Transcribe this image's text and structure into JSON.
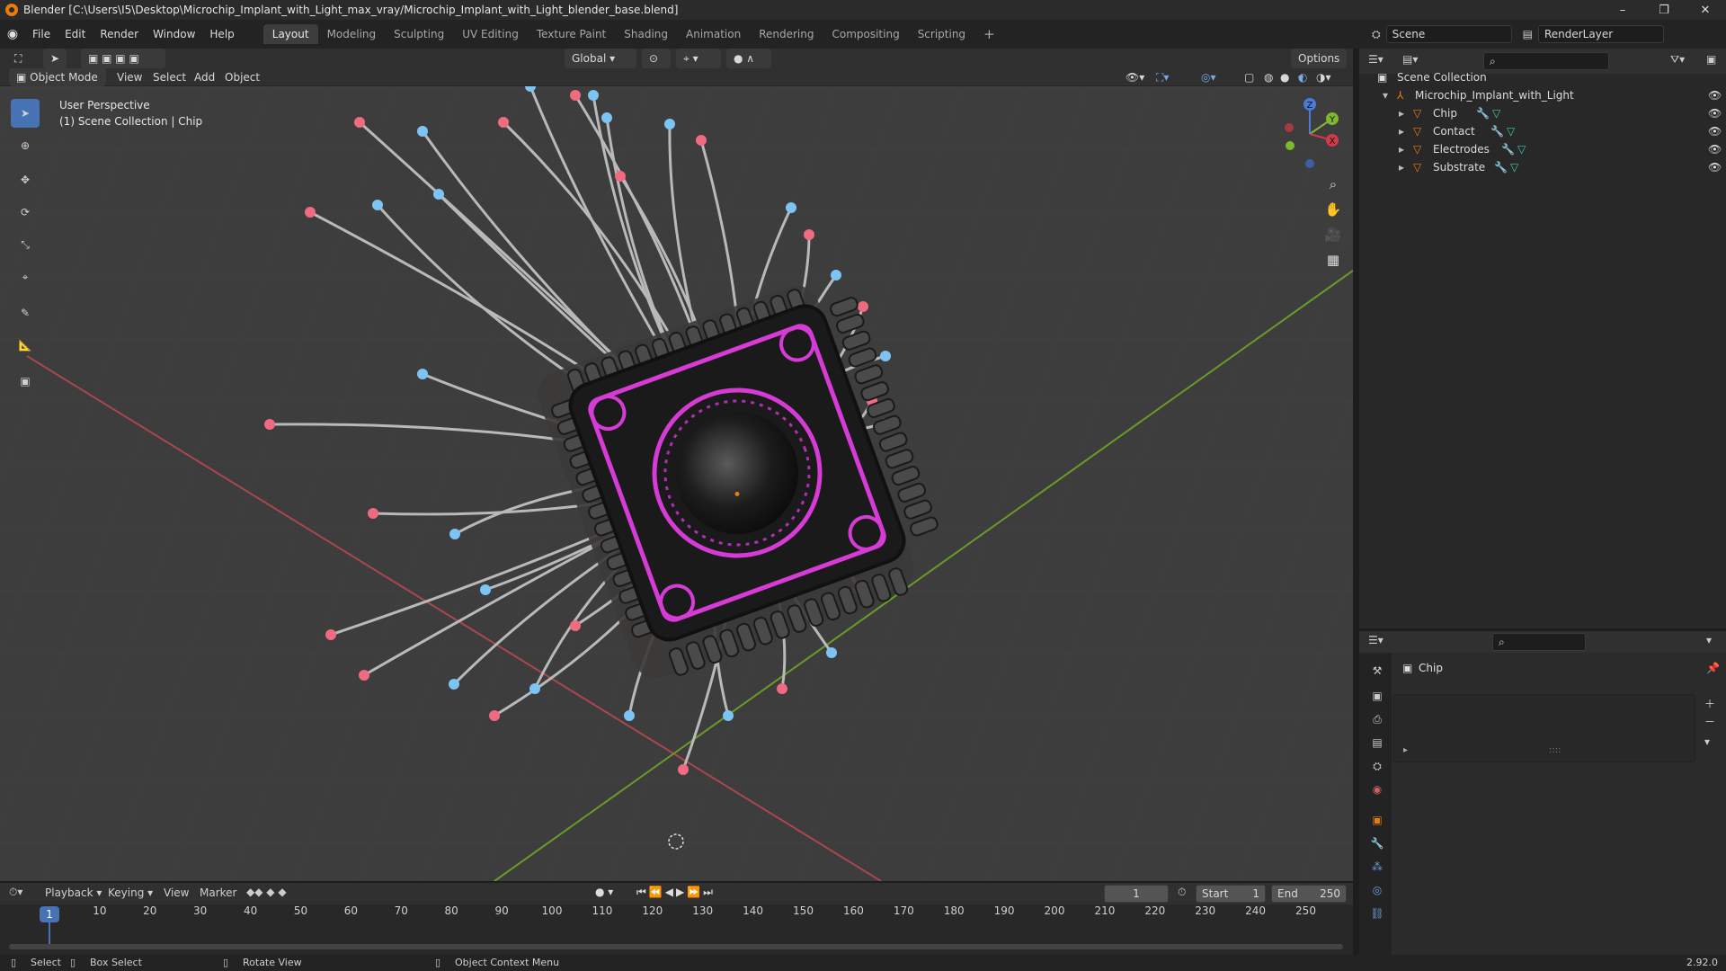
{
  "window": {
    "title": "Blender [C:\\Users\\I5\\Desktop\\Microchip_Implant_with_Light_max_vray/Microchip_Implant_with_Light_blender_base.blend]",
    "minimize": "–",
    "maximize": "❐",
    "close": "✕"
  },
  "menubar": {
    "items": [
      "File",
      "Edit",
      "Render",
      "Window",
      "Help"
    ],
    "workspaces": [
      "Layout",
      "Modeling",
      "Sculpting",
      "UV Editing",
      "Texture Paint",
      "Shading",
      "Animation",
      "Rendering",
      "Compositing",
      "Scripting"
    ],
    "active_workspace": "Layout",
    "add_tab": "+"
  },
  "scenebar": {
    "scene": "Scene",
    "view_layer": "RenderLayer"
  },
  "viewport_header": {
    "mode": "Object Mode",
    "menus": [
      "View",
      "Select",
      "Add",
      "Object"
    ],
    "transform_orientation": "Global",
    "options": "Options"
  },
  "viewport": {
    "perspective": "User Perspective",
    "collection_info": "(1) Scene Collection | Chip",
    "gizmo": {
      "x": "X",
      "y": "Y",
      "z": "Z"
    }
  },
  "outliner": {
    "root": "Scene Collection",
    "collection": "Microchip_Implant_with_Light",
    "objects": [
      "Chip",
      "Contact",
      "Electrodes",
      "Substrate"
    ]
  },
  "properties": {
    "object_name": "Chip",
    "list_grip": "::::"
  },
  "timeline": {
    "menus": [
      "Playback",
      "Keying",
      "View",
      "Marker"
    ],
    "current_frame": "1",
    "start_label": "Start",
    "start": "1",
    "end_label": "End",
    "end": "250",
    "ticks": [
      "10",
      "20",
      "30",
      "40",
      "50",
      "60",
      "70",
      "80",
      "90",
      "100",
      "110",
      "120",
      "130",
      "140",
      "150",
      "160",
      "170",
      "180",
      "190",
      "200",
      "210",
      "220",
      "230",
      "240",
      "250"
    ],
    "playhead": "1"
  },
  "statusbar": {
    "select": "Select",
    "box_select": "Box Select",
    "rotate_view": "Rotate View",
    "context_menu": "Object Context Menu",
    "version": "2.92.0"
  },
  "colors": {
    "accent": "#4772b3",
    "orange": "#e87d0d",
    "x_axis": "#b5474f",
    "y_axis": "#6a9a2a",
    "neon": "#d63bd6"
  }
}
